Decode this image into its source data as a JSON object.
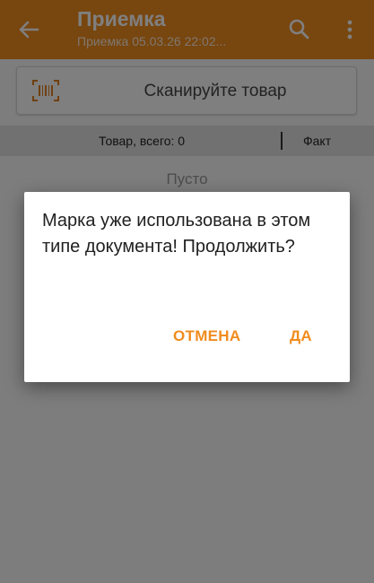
{
  "appbar": {
    "title": "Приемка",
    "subtitle": "Приемка 05.03.26 22:02...",
    "back_icon": "arrow-left-icon",
    "search_icon": "search-icon",
    "more_icon": "more-vertical-icon",
    "color": "#f08c1e"
  },
  "scan": {
    "label": "Сканируйте товар",
    "icon": "barcode-icon"
  },
  "table_header": {
    "total_label": "Товар, всего: 0",
    "fact_label": "Факт"
  },
  "list": {
    "empty_label": "Пусто"
  },
  "dialog": {
    "message": "Марка уже использована в этом типе документа! Продолжить?",
    "cancel_label": "ОТМЕНА",
    "confirm_label": "ДА",
    "accent": "#f08c1e"
  }
}
